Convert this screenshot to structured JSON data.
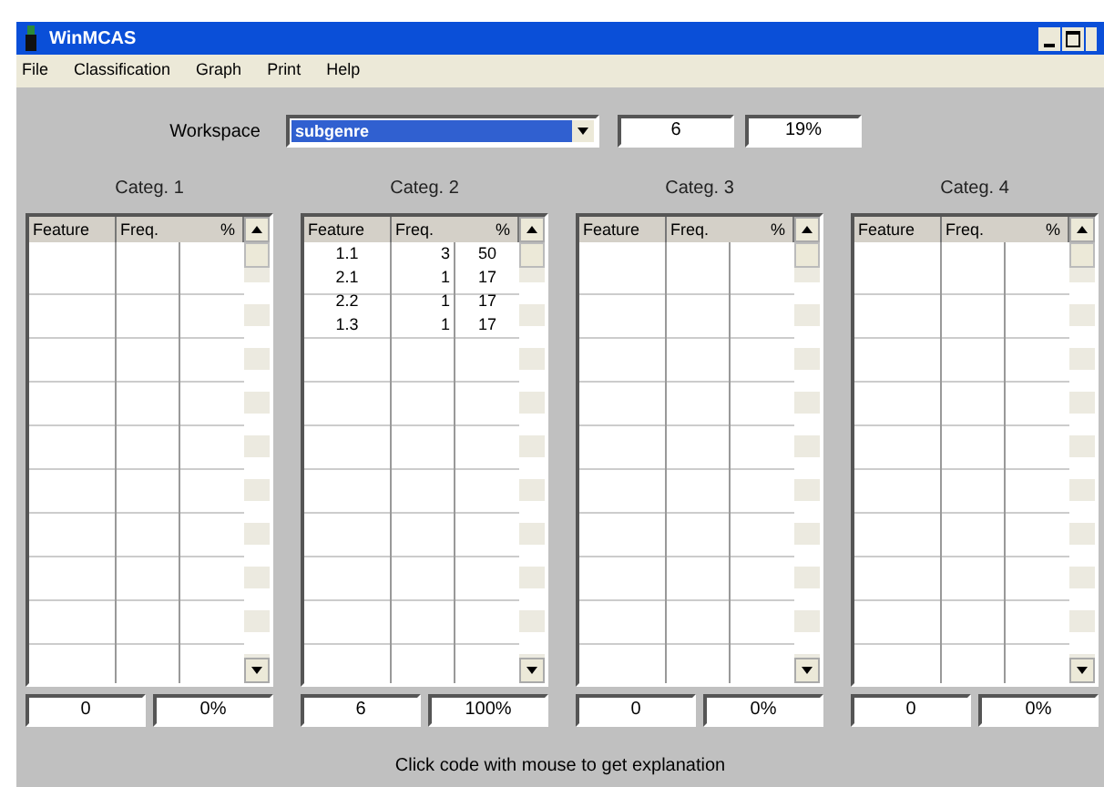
{
  "window": {
    "title": "WinMCAS"
  },
  "menu": [
    "File",
    "Classification",
    "Graph",
    "Print",
    "Help"
  ],
  "workspace": {
    "label": "Workspace",
    "value": "subgenre",
    "count": "6",
    "percent": "19%"
  },
  "categories": [
    {
      "title": "Categ. 1",
      "columns": [
        "Feature",
        "Freq.",
        "%"
      ],
      "total": "0",
      "total_percent": "0%"
    },
    {
      "title": "Categ. 2",
      "columns": [
        "Feature",
        "Freq.",
        "%"
      ],
      "rows": [
        [
          "1.1",
          "3",
          "50"
        ],
        [
          "2.1",
          "1",
          "17"
        ],
        [
          "2.2",
          "1",
          "17"
        ],
        [
          "1.3",
          "1",
          "17"
        ]
      ],
      "total": "6",
      "total_percent": "100%"
    },
    {
      "title": "Categ. 3",
      "columns": [
        "Feature",
        "Freq.",
        "%"
      ],
      "total": "0",
      "total_percent": "0%"
    },
    {
      "title": "Categ. 4",
      "columns": [
        "Feature",
        "Freq.",
        "%"
      ],
      "total": "0",
      "total_percent": "0%"
    }
  ],
  "status": "Click code with mouse to get explanation"
}
